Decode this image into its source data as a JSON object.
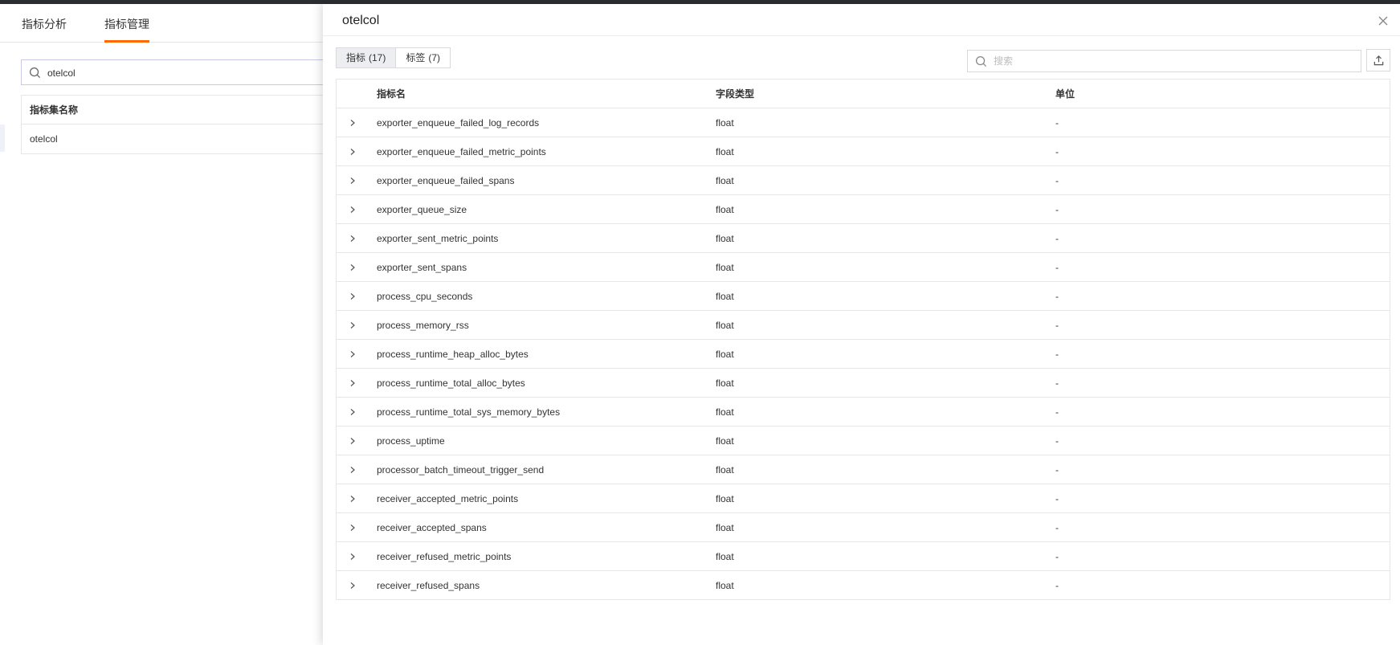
{
  "page": {
    "tabs": [
      {
        "label": "指标分析",
        "active": false
      },
      {
        "label": "指标管理",
        "active": true
      }
    ],
    "search_value": "otelcol",
    "set_table": {
      "header": "指标集名称",
      "rows": [
        "otelcol"
      ]
    }
  },
  "drawer": {
    "title": "otelcol",
    "segments": [
      {
        "label": "指标",
        "count": "(17)",
        "active": true
      },
      {
        "label": "标签",
        "count": "(7)",
        "active": false
      }
    ],
    "search_placeholder": "搜索",
    "columns": {
      "name": "指标名",
      "type": "字段类型",
      "unit": "单位"
    },
    "rows": [
      {
        "name": "exporter_enqueue_failed_log_records",
        "type": "float",
        "unit": "-"
      },
      {
        "name": "exporter_enqueue_failed_metric_points",
        "type": "float",
        "unit": "-"
      },
      {
        "name": "exporter_enqueue_failed_spans",
        "type": "float",
        "unit": "-"
      },
      {
        "name": "exporter_queue_size",
        "type": "float",
        "unit": "-"
      },
      {
        "name": "exporter_sent_metric_points",
        "type": "float",
        "unit": "-"
      },
      {
        "name": "exporter_sent_spans",
        "type": "float",
        "unit": "-"
      },
      {
        "name": "process_cpu_seconds",
        "type": "float",
        "unit": "-"
      },
      {
        "name": "process_memory_rss",
        "type": "float",
        "unit": "-"
      },
      {
        "name": "process_runtime_heap_alloc_bytes",
        "type": "float",
        "unit": "-"
      },
      {
        "name": "process_runtime_total_alloc_bytes",
        "type": "float",
        "unit": "-"
      },
      {
        "name": "process_runtime_total_sys_memory_bytes",
        "type": "float",
        "unit": "-"
      },
      {
        "name": "process_uptime",
        "type": "float",
        "unit": "-"
      },
      {
        "name": "processor_batch_timeout_trigger_send",
        "type": "float",
        "unit": "-"
      },
      {
        "name": "receiver_accepted_metric_points",
        "type": "float",
        "unit": "-"
      },
      {
        "name": "receiver_accepted_spans",
        "type": "float",
        "unit": "-"
      },
      {
        "name": "receiver_refused_metric_points",
        "type": "float",
        "unit": "-"
      },
      {
        "name": "receiver_refused_spans",
        "type": "float",
        "unit": "-"
      }
    ]
  },
  "icons": {
    "search": "search-icon",
    "close": "close-icon",
    "export": "export-icon",
    "expand": "chevron-right-icon"
  },
  "colors": {
    "accent": "#ff6a00",
    "topbar": "#2b2d31",
    "segment_active_bg": "#eceef2"
  }
}
